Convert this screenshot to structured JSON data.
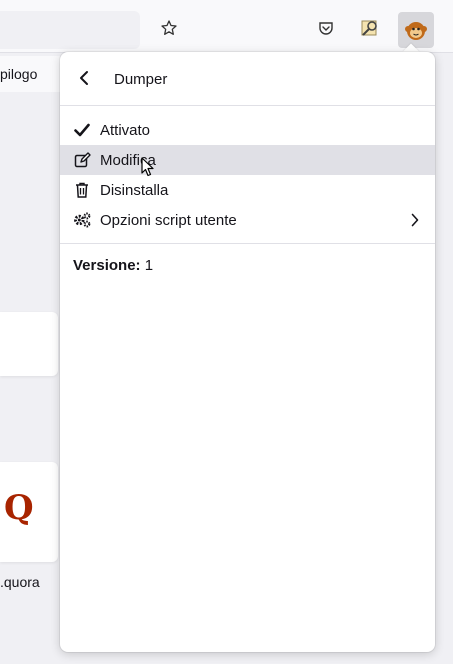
{
  "toolbar": {
    "icons": [
      "star-search-icon",
      "pocket-icon",
      "image-search-icon",
      "tampermonkey-icon"
    ]
  },
  "background": {
    "bookmark_text": "pilogo",
    "card_url_text": ".quora",
    "card_logo": "Q"
  },
  "panel": {
    "title": "Dumper",
    "items": [
      {
        "label": "Attivato",
        "icon": "check-icon"
      },
      {
        "label": "Modifica",
        "icon": "edit-icon"
      },
      {
        "label": "Disinstalla",
        "icon": "trash-icon"
      },
      {
        "label": "Opzioni script utente",
        "icon": "gears-icon"
      }
    ],
    "version_label": "Versione:",
    "version_value": "1"
  },
  "colors": {
    "accent_logo": "#a82400",
    "hover": "#e0e0e6"
  }
}
